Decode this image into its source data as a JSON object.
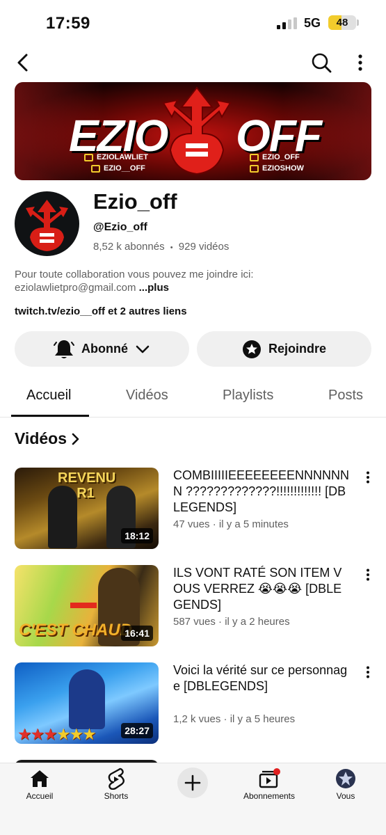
{
  "status_bar": {
    "time": "17:59",
    "network": "5G",
    "battery": "48",
    "battery_level": 0.48
  },
  "banner": {
    "left_text": "EZIO",
    "right_text": "OFF",
    "socials": [
      "EZIOLAWLIET",
      "EZIO__OFF",
      "EZIO_OFF",
      "EZIOSHOW"
    ]
  },
  "channel": {
    "name": "Ezio_off",
    "handle": "@Ezio_off",
    "subscribers": "8,52 k abonnés",
    "separator": "•",
    "videos": "929 vidéos",
    "description_line1": "Pour toute collaboration vous pouvez me joindre ici:",
    "description_line2": "eziolawlietpro@gmail.com",
    "description_more": "...plus",
    "links": "twitch.tv/ezio__off et 2 autres liens"
  },
  "actions": {
    "subscribed_label": "Abonné",
    "join_label": "Rejoindre"
  },
  "tabs": [
    "Accueil",
    "Vidéos",
    "Playlists",
    "Posts"
  ],
  "section": {
    "title": "Vidéos"
  },
  "videos": [
    {
      "title": "COMBIIIIIEEEEEEEENNNNNNN ?????????????!!!!!!!!!!!!! [DBLEGENDS]",
      "meta": "47 vues · il y a 5 minutes",
      "duration": "18:12",
      "thumb_text": "REVENU R1"
    },
    {
      "title": "ILS VONT RATÉ SON ITEM VOUS VERREZ 😭😭😭 [DBLEGENDS]",
      "meta": "587 vues · il y a 2 heures",
      "duration": "16:41",
      "thumb_text": "C'EST CHAUD"
    },
    {
      "title": "Voici la vérité sur ce personnage [DBLEGENDS]",
      "meta": "1,2 k vues · il y a 5 heures",
      "duration": "28:27"
    }
  ],
  "bottom_nav": {
    "home": "Accueil",
    "shorts": "Shorts",
    "subscriptions": "Abonnements",
    "you": "Vous"
  },
  "colors": {
    "brand_red": "#c2120f",
    "accent_yellow": "#f2cc2c",
    "text_primary": "#0f0f0f",
    "text_secondary": "#606060"
  }
}
